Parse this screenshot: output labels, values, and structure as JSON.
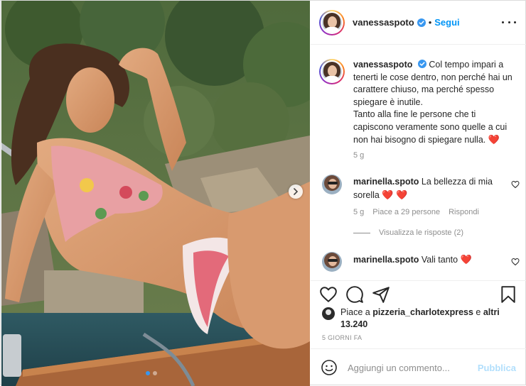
{
  "post": {
    "username": "vanessaspoto",
    "separator": "•",
    "follow_label": "Segui"
  },
  "caption": {
    "username": "vanessaspoto",
    "text": "Col tempo impari a tenerti le cose dentro, non perché hai un carattere chiuso, ma perché spesso spiegare è inutile.\nTanto alla fine le persone che ti capiscono veramente sono quelle a cui non hai bisogno di spiegare nulla.",
    "emoji": "❤️",
    "time": "5 g"
  },
  "comments": [
    {
      "username": "marinella.spoto",
      "text": "La bellezza di mia sorella",
      "emoji": "❤️ ❤️",
      "time": "5 g",
      "likes": "Piace a 29 persone",
      "reply_label": "Rispondi"
    },
    {
      "username": "marinella.spoto",
      "text": "Vali tanto",
      "emoji": "❤️"
    }
  ],
  "replies_label": "Visualizza le risposte (2)",
  "likes": {
    "prefix": "Piace a",
    "user": "pizzeria_charlotexpress",
    "suffix": "e",
    "others": "altri 13.240"
  },
  "time_ago": "5 GIORNI FA",
  "add_comment": {
    "placeholder": "Aggiungi un commento...",
    "publish_label": "Pubblica"
  },
  "colors": {
    "accent": "#0095f6",
    "publish_disabled": "#b2dffc",
    "heart": "#e01f3d",
    "carousel_active_dot": "#3897f0"
  },
  "icons": {
    "verified": "verified-badge-icon",
    "more": "more-options-icon",
    "like": "heart-icon",
    "comment": "comment-icon",
    "share": "paper-plane-icon",
    "save": "bookmark-icon",
    "emoji": "smiley-icon",
    "carousel_next": "chevron-right-icon"
  }
}
